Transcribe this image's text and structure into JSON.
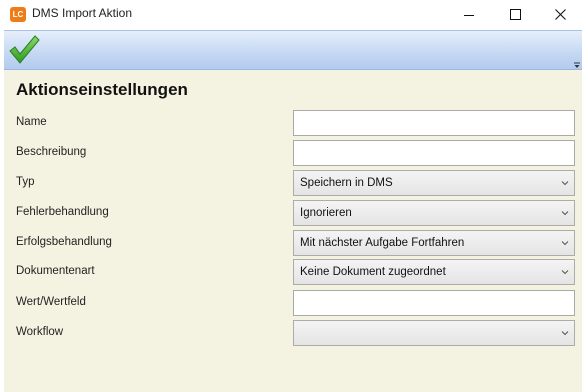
{
  "window": {
    "icon_text": "LC",
    "title": "DMS Import Aktion"
  },
  "toolbar": {
    "confirm_icon": "check-icon"
  },
  "section": {
    "title": "Aktionseinstellungen"
  },
  "form": {
    "name": {
      "label": "Name",
      "value": ""
    },
    "beschreibung": {
      "label": "Beschreibung",
      "value": ""
    },
    "typ": {
      "label": "Typ",
      "value": "Speichern in DMS"
    },
    "fehlerbehandlung": {
      "label": "Fehlerbehandlung",
      "value": "Ignorieren"
    },
    "erfolgsbehandlung": {
      "label": "Erfolgsbehandlung",
      "value": "Mit nächster Aufgabe Fortfahren"
    },
    "dokumentenart": {
      "label": "Dokumentenart",
      "value": "Keine Dokument zugeordnet"
    },
    "wert": {
      "label": "Wert/Wertfeld",
      "value": ""
    },
    "workflow": {
      "label": "Workflow",
      "value": ""
    }
  },
  "colors": {
    "accent": "#b3cbef",
    "panel_bg": "#f4f3e2",
    "check_green": "#3aa82e"
  }
}
